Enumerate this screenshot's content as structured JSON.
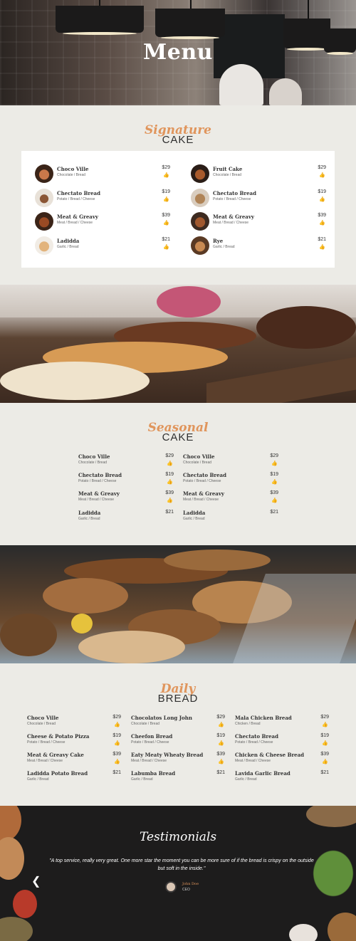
{
  "hero": {
    "title": "Menu"
  },
  "signature": {
    "script": "Signature",
    "caps": "CAKE",
    "items": [
      {
        "name": "Choco Ville",
        "desc": "Chocolate / Bread",
        "price": "$29"
      },
      {
        "name": "Fruit Cake",
        "desc": "Chocolate / Bread",
        "price": "$29"
      },
      {
        "name": "Chectato Bread",
        "desc": "Potato / Bread / Cheese",
        "price": "$19"
      },
      {
        "name": "Chectato Bread",
        "desc": "Potato / Bread / Cheese",
        "price": "$19"
      },
      {
        "name": "Meat & Greavy",
        "desc": "Meat / Bread / Cheese",
        "price": "$39"
      },
      {
        "name": "Meat & Greavy",
        "desc": "Meat / Bread / Cheese",
        "price": "$39"
      },
      {
        "name": "Ladidda",
        "desc": "Garlic / Bread",
        "price": "$21"
      },
      {
        "name": "Rye",
        "desc": "Garlic / Bread",
        "price": "$21"
      }
    ]
  },
  "seasonal": {
    "script": "Seasonal",
    "caps": "CAKE",
    "items": [
      {
        "name": "Choco Ville",
        "desc": "Chocolate / Bread",
        "price": "$29"
      },
      {
        "name": "Choco Ville",
        "desc": "Chocolate / Bread",
        "price": "$29"
      },
      {
        "name": "Chectato Bread",
        "desc": "Potato / Bread / Cheese",
        "price": "$19"
      },
      {
        "name": "Chectato Bread",
        "desc": "Potato / Bread / Cheese",
        "price": "$19"
      },
      {
        "name": "Meat & Greavy",
        "desc": "Meat / Bread / Cheese",
        "price": "$39"
      },
      {
        "name": "Meat & Greavy",
        "desc": "Meat / Bread / Cheese",
        "price": "$39"
      },
      {
        "name": "Ladidda",
        "desc": "Garlic / Bread",
        "price": "$21"
      },
      {
        "name": "Ladidda",
        "desc": "Garlic / Bread",
        "price": "$21"
      }
    ]
  },
  "daily": {
    "script": "Daily",
    "caps": "BREAD",
    "items": [
      {
        "name": "Choco Ville",
        "desc": "Chocolate / Bread",
        "price": "$29"
      },
      {
        "name": "Chocolatos Long John",
        "desc": "Chocolate / Bread",
        "price": "$29"
      },
      {
        "name": "Mala Chicken Bread",
        "desc": "Chicken / Bread",
        "price": "$29"
      },
      {
        "name": "Cheese & Potato Pizza",
        "desc": "Potato / Bread / Cheese",
        "price": "$19"
      },
      {
        "name": "Cheefon Bread",
        "desc": "Potato / Bread / Cheese",
        "price": "$19"
      },
      {
        "name": "Chectato Bread",
        "desc": "Potato / Bread / Cheese",
        "price": "$19"
      },
      {
        "name": "Meat & Greavy Cake",
        "desc": "Meat / Bread / Cheese",
        "price": "$39"
      },
      {
        "name": "Eaty Meaty Wheaty Bread",
        "desc": "Meat / Bread / Cheese",
        "price": "$39"
      },
      {
        "name": "Chicken & Cheese Bread",
        "desc": "Meat / Bread / Cheese",
        "price": "$39"
      },
      {
        "name": "Ladidda Potato Bread",
        "desc": "Garlic / Bread",
        "price": "$21"
      },
      {
        "name": "Labumba Bread",
        "desc": "Garlic / Bread",
        "price": "$21"
      },
      {
        "name": "Lavida Garlic Bread",
        "desc": "Garlic / Bread",
        "price": "$21"
      }
    ]
  },
  "testimonials": {
    "title": "Testimonials",
    "quote": "\"A top service, really very great. One more star the moment you can be more sure of if the bread is crispy on the outside but soft in the inside.\"",
    "author": "John Doe",
    "role": "CEO"
  },
  "icons": {
    "like": "thumbs-up-icon",
    "prev": "chevron-left-icon"
  },
  "colors": {
    "accent": "#e0955c",
    "background": "#ecebe6",
    "card": "#ffffff",
    "dark": "#1d1c1c"
  }
}
